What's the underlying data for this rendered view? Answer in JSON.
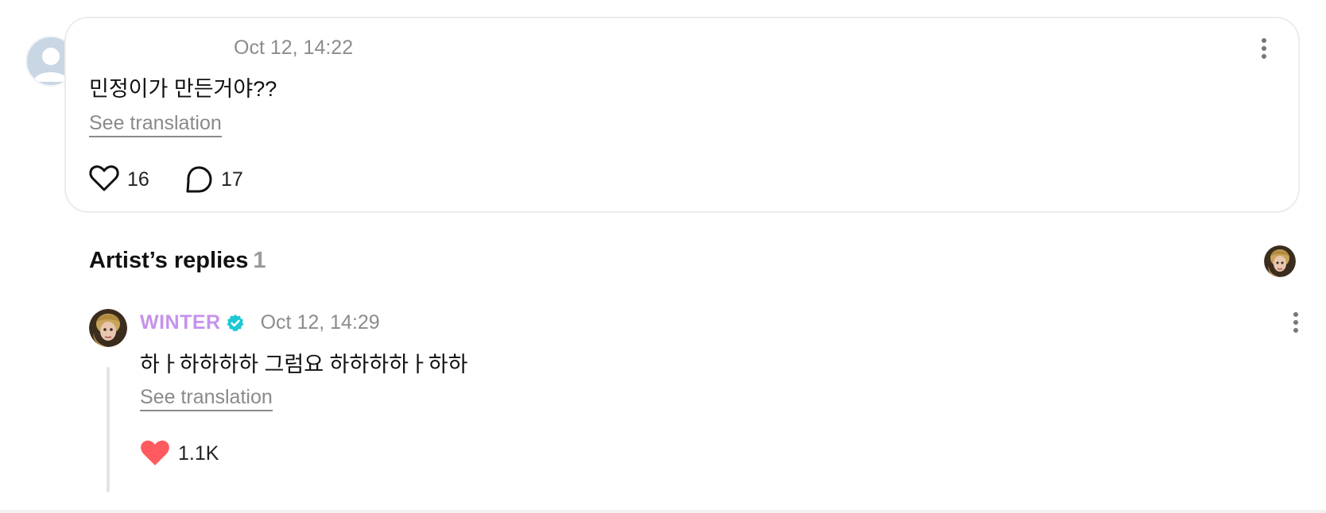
{
  "comment": {
    "timestamp": "Oct 12, 14:22",
    "text": "민정이가 만든거야??",
    "see_translation": "See translation",
    "like_count": "16",
    "reply_count": "17"
  },
  "artist_replies": {
    "title": "Artist’s replies",
    "count": "1"
  },
  "reply": {
    "author": "WINTER",
    "timestamp": "Oct 12, 14:29",
    "text": "하ㅏ하하하하 그럼요 하하하하ㅏ하하",
    "see_translation": "See translation",
    "like_count": "1.1K"
  },
  "colors": {
    "artist_name": "#c592ec",
    "verified_badge": "#1fc7d4",
    "liked_heart": "#ff5a5f",
    "muted_text": "#8c8c8c",
    "card_border": "#ececec"
  },
  "icons": {
    "default_avatar": "user-silhouette-icon",
    "more": "kebab-menu-icon",
    "like": "heart-outline-icon",
    "reply": "speech-bubble-icon",
    "verified": "verified-badge-icon",
    "liked": "heart-filled-icon"
  }
}
